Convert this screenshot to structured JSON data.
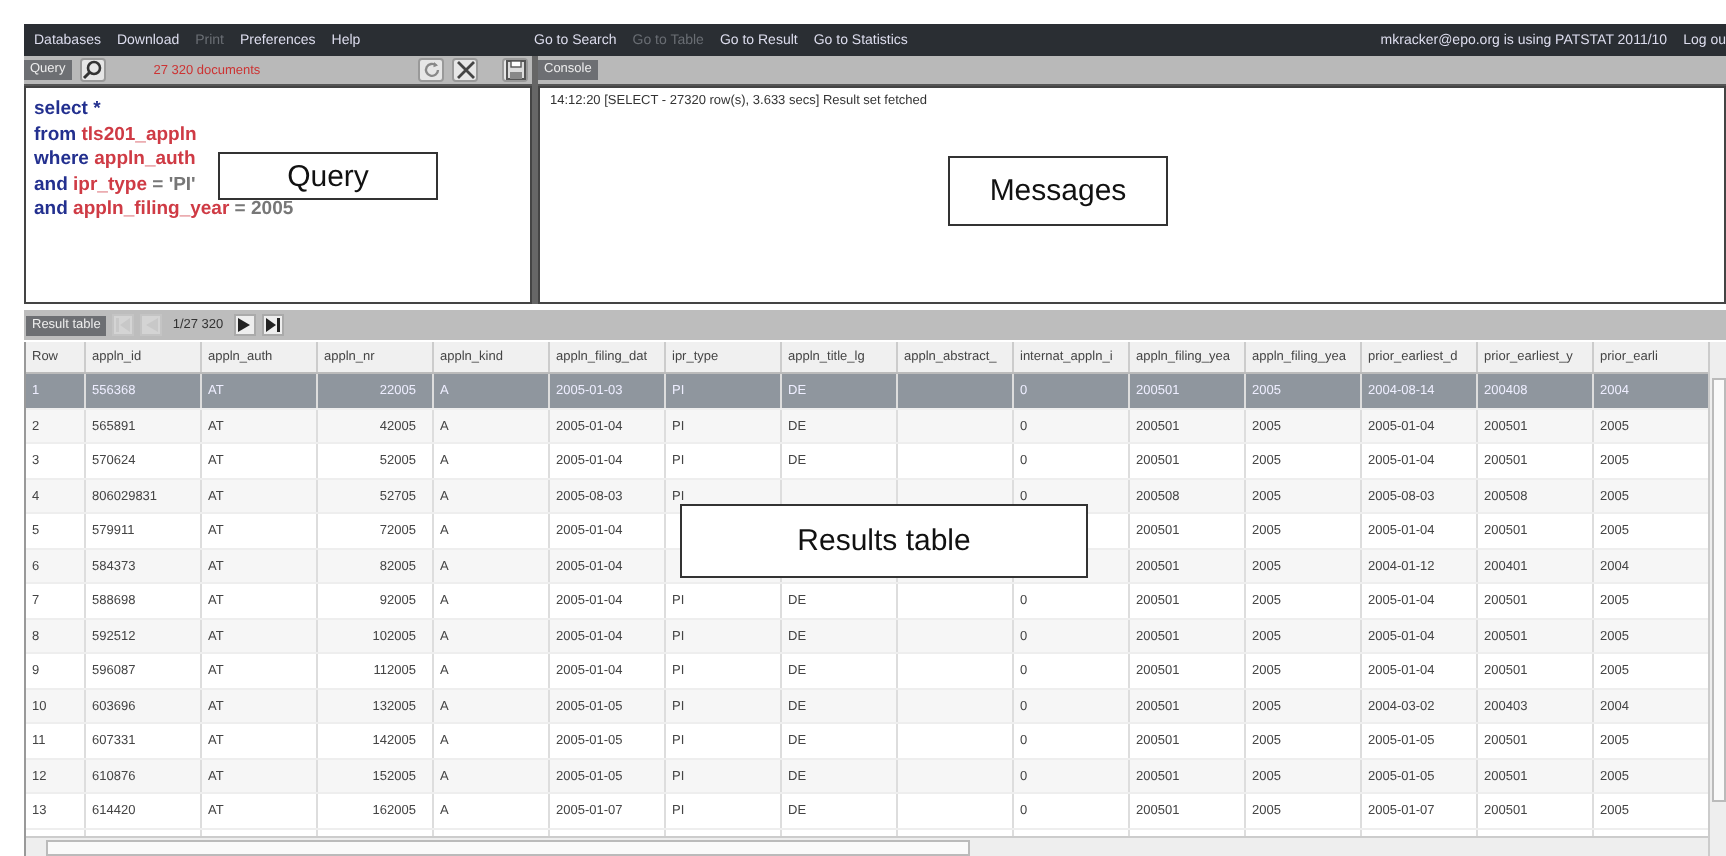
{
  "menu_left": [
    {
      "label": "Databases",
      "disabled": false
    },
    {
      "label": "Download",
      "disabled": false
    },
    {
      "label": "Print",
      "disabled": true
    },
    {
      "label": "Preferences",
      "disabled": false
    },
    {
      "label": "Help",
      "disabled": false
    }
  ],
  "menu_center": [
    {
      "label": "Go to Search",
      "disabled": false
    },
    {
      "label": "Go to Table",
      "disabled": true
    },
    {
      "label": "Go to Result",
      "disabled": false
    },
    {
      "label": "Go to Statistics",
      "disabled": false
    }
  ],
  "user_info": "mkracker@epo.org  is using  PATSTAT 2011/10",
  "logout": "Log ou",
  "query_panel": {
    "tab": "Query",
    "count": "27 320 documents",
    "lines": [
      [
        {
          "text": "select *",
          "kind": "keyword"
        }
      ],
      [
        {
          "text": "from ",
          "kind": "keyword"
        },
        {
          "text": "tls201_appln",
          "kind": "identifier"
        }
      ],
      [
        {
          "text": "where ",
          "kind": "keyword"
        },
        {
          "text": "appln_auth",
          "kind": "identifier"
        }
      ],
      [
        {
          "text": "and ",
          "kind": "keyword"
        },
        {
          "text": "ipr_type",
          "kind": "identifier"
        },
        {
          "text": " = 'PI'",
          "kind": "plain"
        }
      ],
      [
        {
          "text": "and ",
          "kind": "keyword"
        },
        {
          "text": "appln_filing_year",
          "kind": "identifier"
        },
        {
          "text": " = 2005",
          "kind": "plain"
        }
      ]
    ]
  },
  "console_panel": {
    "tab": "Console",
    "message": "14:12:20 [SELECT - 27320 row(s), 3.633 secs] Result set fetched"
  },
  "callouts": [
    {
      "text": "Query",
      "kind": "query"
    },
    {
      "text": "Messages",
      "kind": "messages"
    },
    {
      "text": "Results table",
      "kind": "results"
    }
  ],
  "result_toolbar": {
    "tab": "Result table",
    "page": "1/27 320",
    "buttons": [
      {
        "kind": "first",
        "disabled": true
      },
      {
        "kind": "prev",
        "disabled": true
      },
      {
        "kind": "page"
      },
      {
        "kind": "next",
        "disabled": false
      },
      {
        "kind": "last",
        "disabled": false
      }
    ]
  },
  "table": {
    "columns": [
      "Row",
      "appln_id",
      "appln_auth",
      "appln_nr",
      "appln_kind",
      "appln_filing_dat",
      "ipr_type",
      "appln_title_lg",
      "appln_abstract_",
      "internat_appln_i",
      "appln_filing_yea",
      "appln_filing_yea",
      "prior_earliest_d",
      "prior_earliest_y",
      "prior_earli"
    ],
    "rows": [
      {
        "selected": true,
        "cells": [
          "1",
          "556368",
          "AT",
          "22005",
          "A",
          "2005-01-03",
          "PI",
          "DE",
          null,
          "0",
          "200501",
          "2005",
          "2004-08-14",
          "200408",
          "2004"
        ]
      },
      {
        "selected": false,
        "cells": [
          "2",
          "565891",
          "AT",
          "42005",
          "A",
          "2005-01-04",
          "PI",
          "DE",
          null,
          "0",
          "200501",
          "2005",
          "2005-01-04",
          "200501",
          "2005"
        ]
      },
      {
        "selected": false,
        "cells": [
          "3",
          "570624",
          "AT",
          "52005",
          "A",
          "2005-01-04",
          "PI",
          "DE",
          null,
          "0",
          "200501",
          "2005",
          "2005-01-04",
          "200501",
          "2005"
        ]
      },
      {
        "selected": false,
        "cells": [
          "4",
          "806029831",
          "AT",
          "52705",
          "A",
          "2005-08-03",
          "PI",
          null,
          null,
          "0",
          "200508",
          "2005",
          "2005-08-03",
          "200508",
          "2005"
        ]
      },
      {
        "selected": false,
        "cells": [
          "5",
          "579911",
          "AT",
          "72005",
          "A",
          "2005-01-04",
          null,
          null,
          null,
          null,
          "200501",
          "2005",
          "2005-01-04",
          "200501",
          "2005"
        ]
      },
      {
        "selected": false,
        "cells": [
          "6",
          "584373",
          "AT",
          "82005",
          "A",
          "2005-01-04",
          null,
          null,
          null,
          null,
          "200501",
          "2005",
          "2004-01-12",
          "200401",
          "2004"
        ]
      },
      {
        "selected": false,
        "cells": [
          "7",
          "588698",
          "AT",
          "92005",
          "A",
          "2005-01-04",
          "PI",
          "DE",
          null,
          "0",
          "200501",
          "2005",
          "2005-01-04",
          "200501",
          "2005"
        ]
      },
      {
        "selected": false,
        "cells": [
          "8",
          "592512",
          "AT",
          "102005",
          "A",
          "2005-01-04",
          "PI",
          "DE",
          null,
          "0",
          "200501",
          "2005",
          "2005-01-04",
          "200501",
          "2005"
        ]
      },
      {
        "selected": false,
        "cells": [
          "9",
          "596087",
          "AT",
          "112005",
          "A",
          "2005-01-04",
          "PI",
          "DE",
          null,
          "0",
          "200501",
          "2005",
          "2005-01-04",
          "200501",
          "2005"
        ]
      },
      {
        "selected": false,
        "cells": [
          "10",
          "603696",
          "AT",
          "132005",
          "A",
          "2005-01-05",
          "PI",
          "DE",
          null,
          "0",
          "200501",
          "2005",
          "2004-03-02",
          "200403",
          "2004"
        ]
      },
      {
        "selected": false,
        "cells": [
          "11",
          "607331",
          "AT",
          "142005",
          "A",
          "2005-01-05",
          "PI",
          "DE",
          null,
          "0",
          "200501",
          "2005",
          "2005-01-05",
          "200501",
          "2005"
        ]
      },
      {
        "selected": false,
        "cells": [
          "12",
          "610876",
          "AT",
          "152005",
          "A",
          "2005-01-05",
          "PI",
          "DE",
          null,
          "0",
          "200501",
          "2005",
          "2005-01-05",
          "200501",
          "2005"
        ]
      },
      {
        "selected": false,
        "cells": [
          "13",
          "614420",
          "AT",
          "162005",
          "A",
          "2005-01-07",
          "PI",
          "DE",
          null,
          "0",
          "200501",
          "2005",
          "2005-01-07",
          "200501",
          "2005"
        ]
      }
    ]
  }
}
